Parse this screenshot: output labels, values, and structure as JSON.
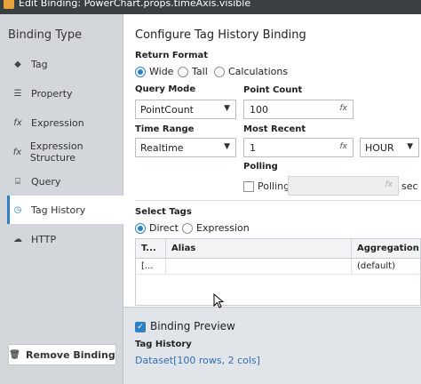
{
  "window": {
    "title": "Edit Binding: PowerChart.props.timeAxis.visible"
  },
  "sidebar": {
    "heading": "Binding Type",
    "items": [
      {
        "label": "Tag",
        "icon": "tag-icon",
        "glyph": "◆",
        "active": false
      },
      {
        "label": "Property",
        "icon": "property-icon",
        "glyph": "☰",
        "active": false
      },
      {
        "label": "Expression",
        "icon": "fx-icon",
        "glyph": "fx",
        "active": false
      },
      {
        "label": "Expression Structure",
        "icon": "fx-icon",
        "glyph": "fx",
        "active": false
      },
      {
        "label": "Query",
        "icon": "database-icon",
        "glyph": "⌸",
        "active": false
      },
      {
        "label": "Tag History",
        "icon": "clock-icon",
        "glyph": "◷",
        "active": true
      },
      {
        "label": "HTTP",
        "icon": "cloud-icon",
        "glyph": "☁",
        "active": false
      }
    ],
    "remove_button": "Remove Binding"
  },
  "main": {
    "heading": "Configure Tag History Binding",
    "return_format": {
      "label": "Return Format",
      "options": [
        "Wide",
        "Tall",
        "Calculations"
      ],
      "selected": "Wide"
    },
    "query_mode": {
      "label": "Query Mode",
      "value": "PointCount"
    },
    "point_count": {
      "label": "Point Count",
      "value": "100"
    },
    "time_range": {
      "label": "Time Range",
      "value": "Realtime"
    },
    "most_recent": {
      "label": "Most Recent",
      "value": "1",
      "unit": "HOUR"
    },
    "polling": {
      "label": "Polling",
      "checkbox_label": "Polling",
      "checked": false,
      "value": "",
      "unit": "sec"
    },
    "select_tags": {
      "label": "Select Tags",
      "options": [
        "Direct",
        "Expression"
      ],
      "selected": "Direct"
    },
    "fx_glyph": "fx",
    "table": {
      "columns": [
        "T...",
        "Alias",
        "Aggregation M"
      ],
      "rows": [
        [
          "[...",
          "",
          "(default)"
        ]
      ]
    }
  },
  "preview": {
    "checkbox_label": "Binding Preview",
    "checked": true,
    "subtitle": "Tag History",
    "value": "Dataset[100 rows, 2 cols]"
  },
  "colors": {
    "accent": "#2f7fc4",
    "link": "#2f6fb5",
    "sidebar_bg": "#d3d7db"
  }
}
